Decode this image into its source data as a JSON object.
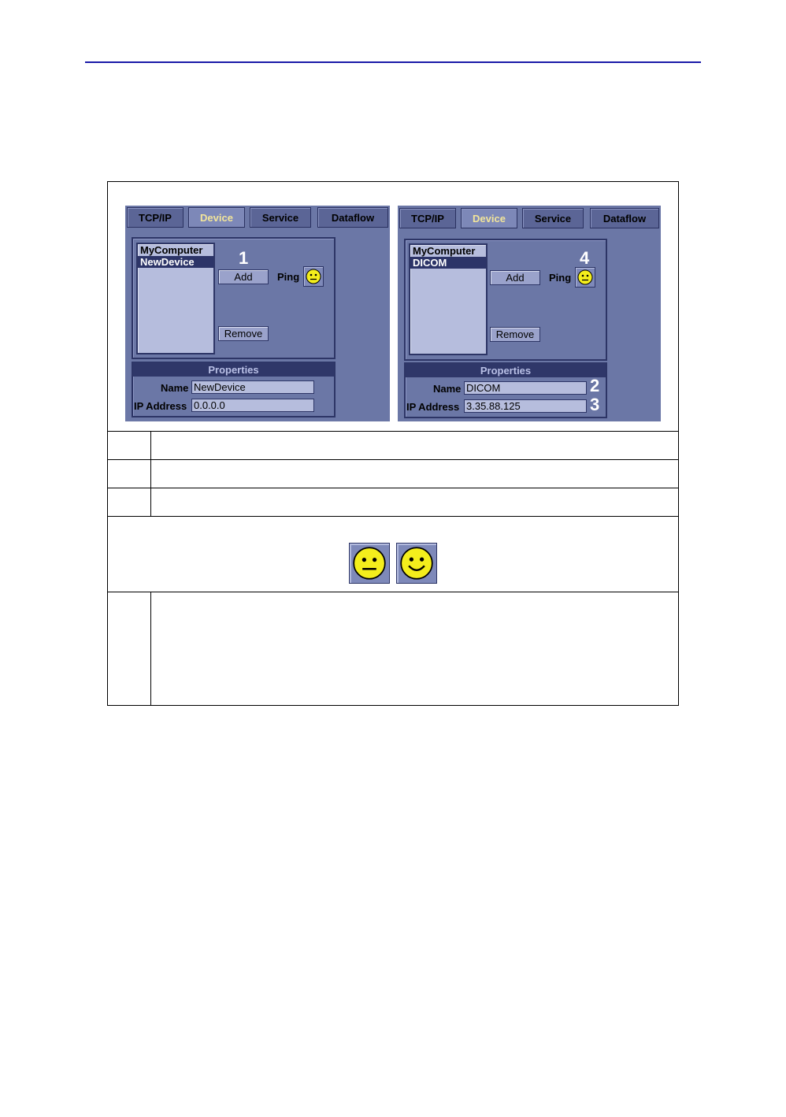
{
  "left_panel": {
    "tabs": [
      "TCP/IP",
      "Device",
      "Service",
      "Dataflow"
    ],
    "active_tab": "Device",
    "list": [
      "MyComputer",
      "NewDevice"
    ],
    "selected": "NewDevice",
    "callout": "1",
    "add_label": "Add",
    "ping_label": "Ping",
    "remove_label": "Remove",
    "properties_title": "Properties",
    "name_label": "Name",
    "name_value": "NewDevice",
    "ip_label": "IP Address",
    "ip_value": "0.0.0.0"
  },
  "right_panel": {
    "tabs": [
      "TCP/IP",
      "Device",
      "Service",
      "Dataflow"
    ],
    "active_tab": "Device",
    "list": [
      "MyComputer",
      "DICOM"
    ],
    "selected": "DICOM",
    "callout_ping": "4",
    "callout_name": "2",
    "callout_ip": "3",
    "add_label": "Add",
    "ping_label": "Ping",
    "remove_label": "Remove",
    "properties_title": "Properties",
    "name_label": "Name",
    "name_value": "DICOM",
    "ip_label": "IP Address",
    "ip_value": "3.35.88.125"
  },
  "ping_status_icons": [
    "neutral-face-icon",
    "smiling-face-icon"
  ],
  "colors": {
    "rule": "#1a1aa8",
    "panel": "#6b77a6",
    "active_tab_text": "#f2e59a",
    "face": "#f4ee1c"
  }
}
